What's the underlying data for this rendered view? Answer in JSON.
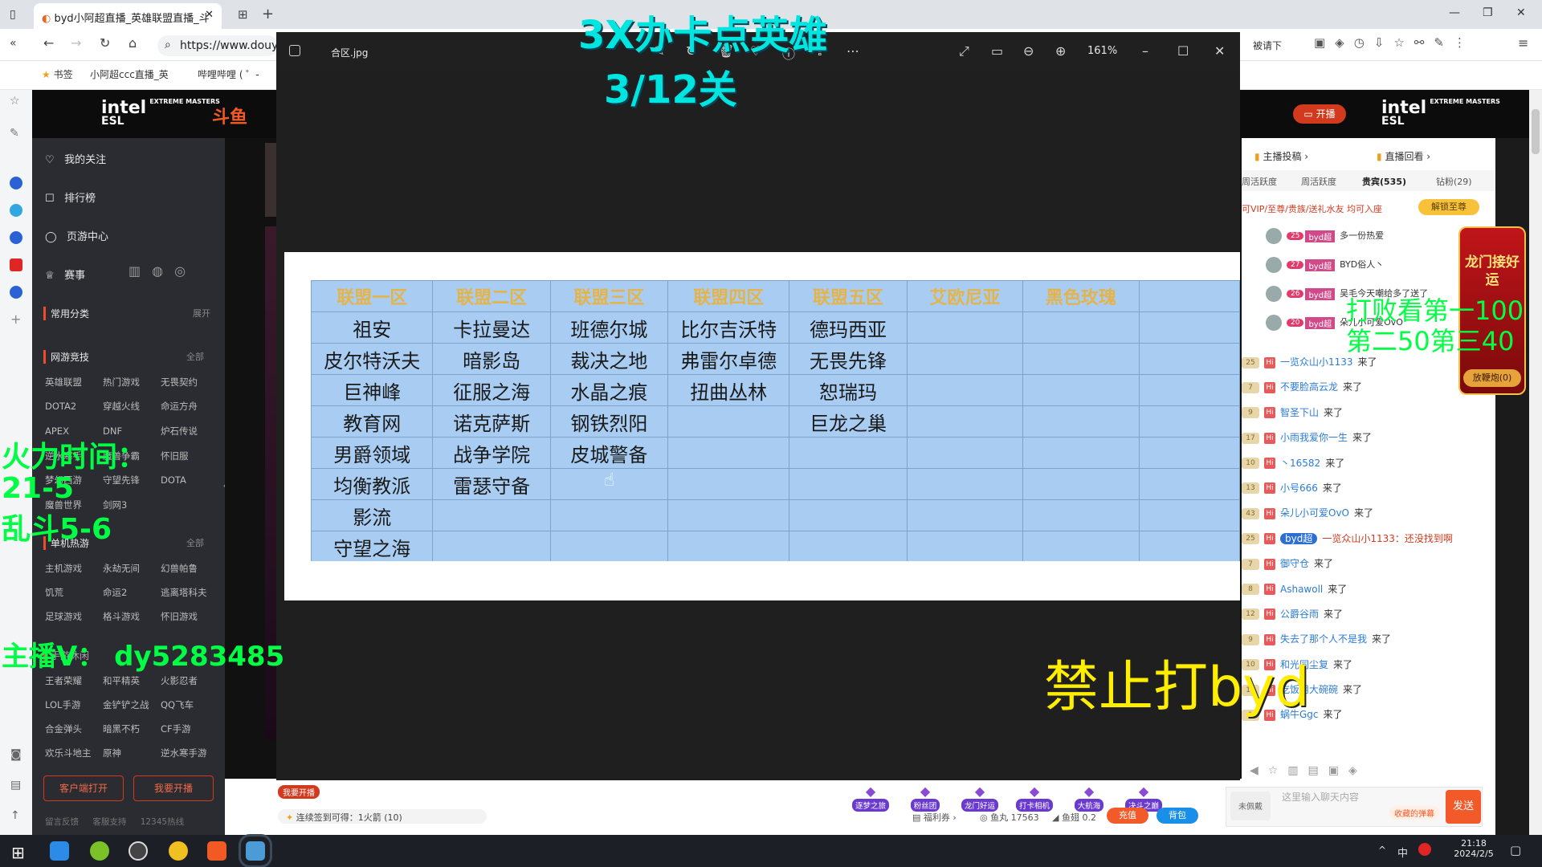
{
  "browser": {
    "tab_title": "byd小阿超直播_英雄联盟直播_斗",
    "address": "https://www.douy",
    "bookmarks": [
      "书签",
      "小阿超ccc直播_英",
      "哔哩哔哩 ( ゜-"
    ],
    "right_text": "被请下",
    "colors": {
      "tabbar": "#dfe3e8",
      "accent": "#1a73e8"
    }
  },
  "page": {
    "brand_left": "intel",
    "brand_sub": "EXTREME MASTERS",
    "brand_esl": "ESL",
    "douyu_logo": "斗鱼",
    "open_live": "开播",
    "avatar_badge": "13",
    "nav_items": [
      "我的关注",
      "排行榜",
      "页游中心",
      "赛事"
    ],
    "common_cat": "常用分类",
    "expand": "展开",
    "sec_online": "网游竞技",
    "all": "全部",
    "online_games": [
      "英雄联盟",
      "热门游戏",
      "无畏契约",
      "DOTA2",
      "穿越火线",
      "命运方舟",
      "APEX",
      "DNF",
      "炉石传说",
      "逆水寒手",
      "魔兽争霸",
      "怀旧服",
      "梦幻西游",
      "守望先锋",
      "DOTA",
      "魔兽世界",
      "剑网3"
    ],
    "sec_single": "单机热游",
    "single_games": [
      "主机游戏",
      "永劫无间",
      "幻兽帕鲁",
      "饥荒",
      "命运2",
      "逃离塔科夫",
      "足球游戏",
      "格斗游戏",
      "怀旧游戏"
    ],
    "sec_mobile": "手游休闲",
    "mobile_games": [
      "王者荣耀",
      "和平精英",
      "火影忍者",
      "LOL手游",
      "金铲铲之战",
      "QQ飞车",
      "合金弹头",
      "暗黑不朽",
      "CF手游",
      "欢乐斗地主",
      "原神",
      "逆水寒手游"
    ],
    "btn_client": "客户端打开",
    "btn_live": "我要开播",
    "footer_links": [
      "留言反馈",
      "客服支持",
      "12345热线"
    ],
    "bottom_checkin": "连续签到可得：1火箭 (10)",
    "bottom_welfare": "福利券",
    "fish_balls": "鱼丸 17563",
    "fish_fins": "鱼翅 0.2",
    "recharge": "充值",
    "backpack": "背包",
    "gift_labels": [
      "逐梦之旅",
      "粉丝团",
      "龙门好运",
      "打卡相机",
      "大航海",
      "决斗之巅"
    ],
    "start_live_badge": "我要开播"
  },
  "right_panel": {
    "tabs_top": [
      "主播投稿",
      "直播回看"
    ],
    "tabs": [
      "周活跃度",
      "周活跃度",
      "贵宾(535)",
      "钻粉(29)"
    ],
    "vip_notice": "可VIP/至尊/贵族/送礼水友 均可入座",
    "unlock": "解锁至尊",
    "vip_rows": [
      {
        "lv": "25",
        "tag": "byd超",
        "msg": "多一份热爱"
      },
      {
        "lv": "27",
        "tag": "byd超",
        "msg": "BYD俗人丶"
      },
      {
        "lv": "26",
        "tag": "byd超",
        "msg": "吴毛今天嘲给多了送了"
      },
      {
        "lv": "20",
        "tag": "byd超",
        "msg": "朵儿小可爱OvO"
      }
    ],
    "chat": [
      {
        "lv": "25",
        "name": "一览众山小1133",
        "msg": "来了"
      },
      {
        "lv": "7",
        "name": "不要脸高云龙",
        "msg": "来了"
      },
      {
        "lv": "9",
        "name": "智圣下山",
        "msg": "来了"
      },
      {
        "lv": "17",
        "name": "小雨我爱你一生",
        "msg": "来了"
      },
      {
        "lv": "10",
        "name": "丶16582",
        "msg": "来了"
      },
      {
        "lv": "13",
        "name": "小号666",
        "msg": "来了"
      },
      {
        "lv": "43",
        "name": "朵儿小可爱OvO",
        "msg": "来了"
      },
      {
        "lv": "25",
        "name": "byd超",
        "msg": "一览众山小1133：还没找到啊"
      },
      {
        "lv": "7",
        "name": "御守仓",
        "msg": "来了"
      },
      {
        "lv": "8",
        "name": "Ashawoll",
        "msg": "来了"
      },
      {
        "lv": "12",
        "name": "公爵谷雨",
        "msg": "来了"
      },
      {
        "lv": "9",
        "name": "失去了那个人不是我",
        "msg": "来了"
      },
      {
        "lv": "10",
        "name": "和光同尘复",
        "msg": "来了"
      },
      {
        "lv": "15",
        "name": "吃饭用大碗碗",
        "msg": "来了"
      },
      {
        "lv": "1",
        "name": "蜗牛Ggc",
        "msg": "来了"
      }
    ],
    "chat_placeholder": "这里输入聊天内容",
    "barrage": "收藏的弹幕",
    "send": "发送",
    "unlit": "未佩戴",
    "dragon_title": "龙门接好运",
    "dragon_btn": "放鞭炮(0)"
  },
  "viewer": {
    "filename": "合区.jpg",
    "zoom": "161%",
    "headers": [
      "联盟一区",
      "联盟二区",
      "联盟三区",
      "联盟四区",
      "联盟五区",
      "艾欧尼亚",
      "黑色玫瑰",
      ""
    ],
    "rows": [
      [
        "祖安",
        "卡拉曼达",
        "班德尔城",
        "比尔吉沃特",
        "德玛西亚",
        "",
        "",
        ""
      ],
      [
        "皮尔特沃夫",
        "暗影岛",
        "裁决之地",
        "弗雷尔卓德",
        "无畏先锋",
        "",
        "",
        ""
      ],
      [
        "巨神峰",
        "征服之海",
        "水晶之痕",
        "扭曲丛林",
        "恕瑞玛",
        "",
        "",
        ""
      ],
      [
        "教育网",
        "诺克萨斯",
        "钢铁烈阳",
        "",
        "巨龙之巢",
        "",
        "",
        ""
      ],
      [
        "男爵领域",
        "战争学院",
        "皮城警备",
        "",
        "",
        "",
        "",
        ""
      ],
      [
        "均衡教派",
        "雷瑟守备",
        "",
        "",
        "",
        "",
        "",
        ""
      ],
      [
        "影流",
        "",
        "",
        "",
        "",
        "",
        "",
        ""
      ],
      [
        "守望之海",
        "",
        "",
        "",
        "",
        "",
        "",
        ""
      ]
    ]
  },
  "overlays": {
    "top_line1": "3X办卡点英雄",
    "top_line2": "3/12关",
    "left_line1": "火力时间：",
    "left_line2": "21-5",
    "left_line3": "乱斗5-6",
    "streamer": "主播V：  dy5283485",
    "right_line1": "打败看第一100",
    "right_line2": "第二50第三40",
    "ban": "禁止打byd",
    "colors": {
      "cyan": "#00e5e0",
      "green": "#00ff44",
      "yellow": "#ffee00"
    }
  },
  "taskbar": {
    "time": "21:18",
    "date": "2024/2/5",
    "ime": "中"
  }
}
